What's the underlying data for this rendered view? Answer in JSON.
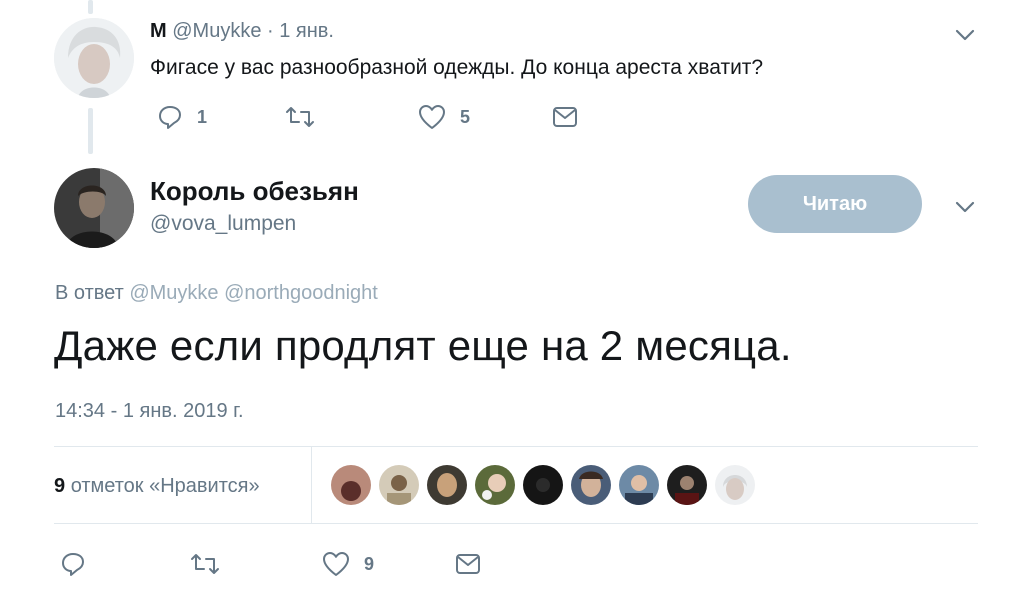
{
  "reply_tweet": {
    "name": "M",
    "handle": "@Muykke",
    "separator": "·",
    "date": "1 янв.",
    "text": "Фигасе у вас разнообразной одежды. До конца ареста хватит?",
    "reply_count": "1",
    "like_count": "5"
  },
  "main_tweet": {
    "name": "Король обезьян",
    "handle": "@vova_lumpen",
    "follow_label": "Читаю",
    "reply_to_prefix": "В ответ",
    "reply_to_handles": "@Muykke @northgoodnight",
    "text": "Даже если продлят еще на 2 месяца.",
    "timestamp": "14:34 - 1 янв. 2019 г."
  },
  "likes_bar": {
    "count": "9",
    "label": "отметок «Нравится»"
  },
  "main_actions": {
    "like_count": "9"
  },
  "icons": [
    "chevron-down-icon",
    "reply-icon",
    "retweet-icon",
    "like-icon",
    "dm-icon"
  ],
  "colors": {
    "muted": "#657786",
    "follow_button": "#a9bfcf",
    "divider": "#e1e8ed"
  }
}
